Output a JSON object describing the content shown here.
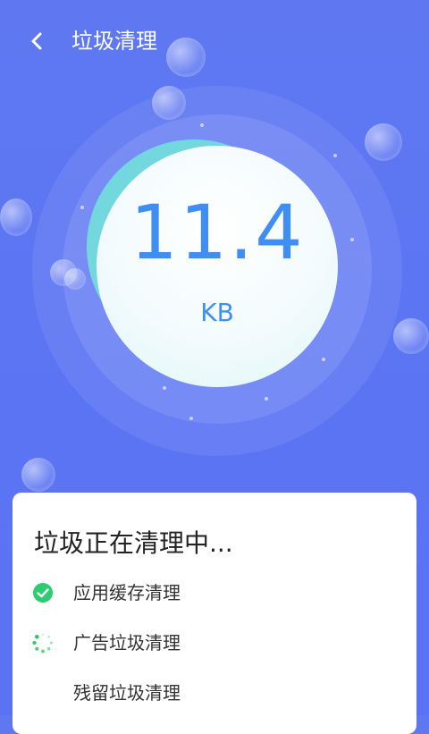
{
  "header": {
    "title": "垃圾清理"
  },
  "scan": {
    "size_value": "11.4",
    "size_unit": "KB"
  },
  "card": {
    "title": "垃圾正在清理中...",
    "tasks": [
      {
        "label": "应用缓存清理",
        "status": "done"
      },
      {
        "label": "广告垃圾清理",
        "status": "in-progress"
      },
      {
        "label": "残留垃圾清理",
        "status": "pending"
      }
    ]
  },
  "colors": {
    "background": "#5f78f2",
    "accent_text": "#3f8ef4",
    "done": "#2ecc71",
    "progress": "#35c466"
  },
  "icons": {
    "back": "chevron-left-icon",
    "done": "check-circle-icon",
    "in_progress": "spinner-icon"
  }
}
